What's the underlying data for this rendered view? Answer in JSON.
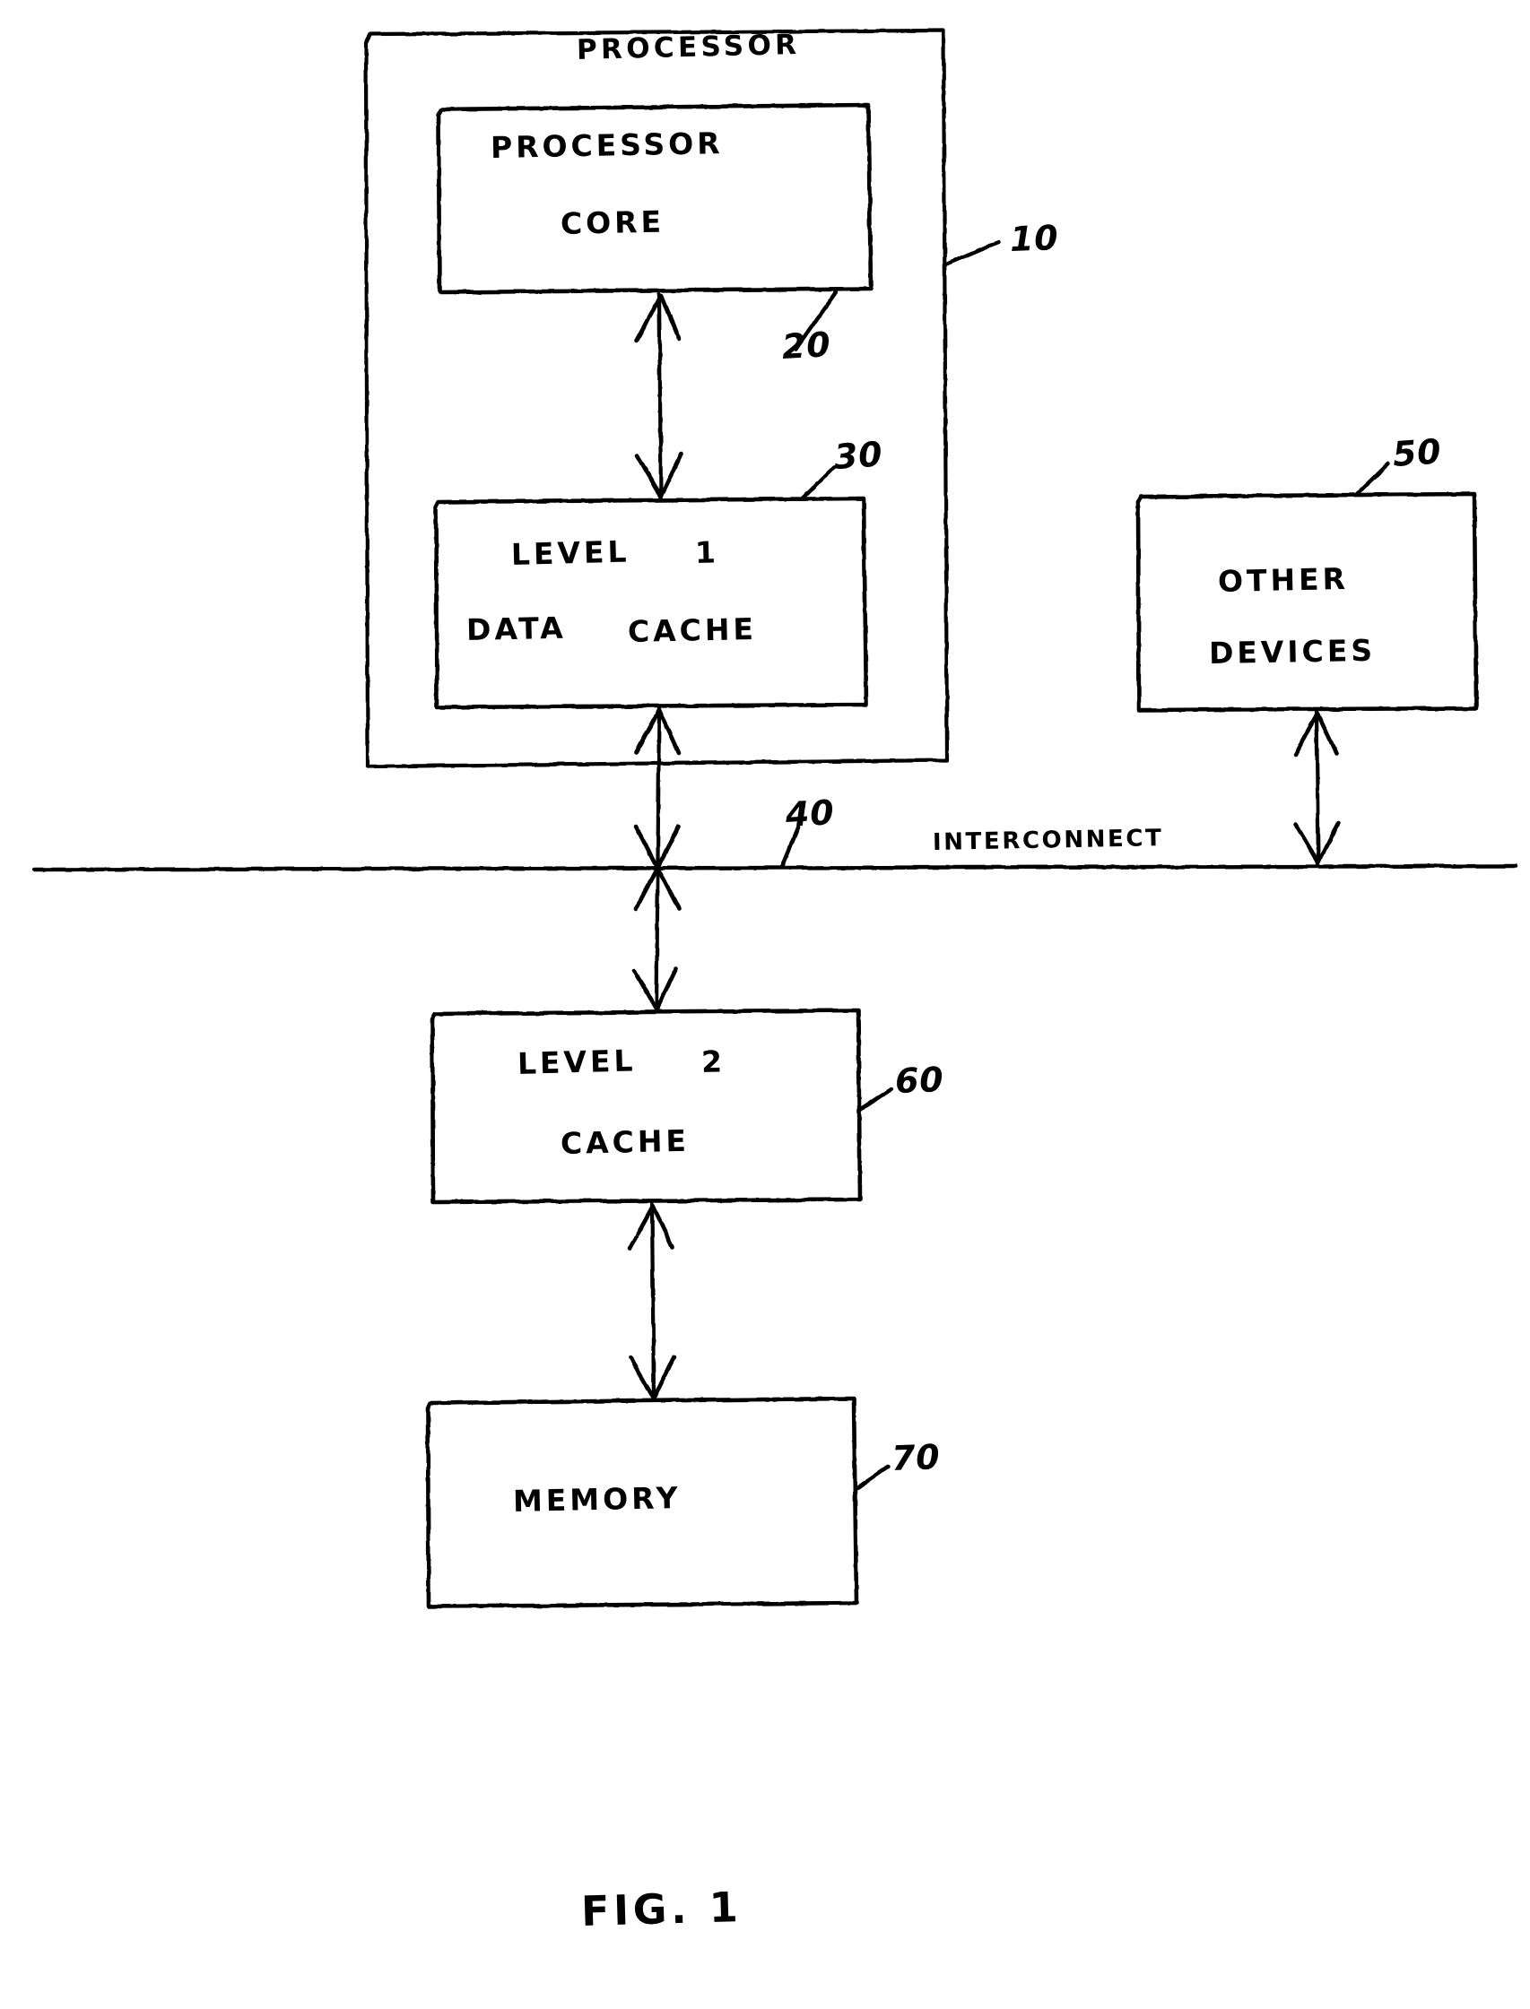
{
  "figure": {
    "caption": "FIG. 1",
    "title_label": "PROCESSOR"
  },
  "blocks": {
    "processor_outer": {
      "label": "PROCESSOR",
      "ref": "10"
    },
    "processor_core": {
      "label_line1": "PROCESSOR",
      "label_line2": "CORE",
      "ref": "20"
    },
    "l1_data_cache": {
      "label_line1": "LEVEL",
      "label_num": "1",
      "label_line2a": "DATA",
      "label_line2b": "CACHE",
      "ref": "30"
    },
    "interconnect": {
      "label": "INTERCONNECT",
      "ref": "40"
    },
    "other_devices": {
      "label_line1": "OTHER",
      "label_line2": "DEVICES",
      "ref": "50"
    },
    "l2_cache": {
      "label_line1": "LEVEL",
      "label_num": "2",
      "label_line2": "CACHE",
      "ref": "60"
    },
    "memory": {
      "label": "MEMORY",
      "ref": "70"
    }
  },
  "connections": [
    {
      "name": "core-to-l1",
      "from": "processor_core",
      "to": "l1_data_cache",
      "style": "double-arrow"
    },
    {
      "name": "l1-to-interconnect",
      "from": "l1_data_cache",
      "to": "interconnect",
      "style": "double-arrow"
    },
    {
      "name": "interconnect-to-l2",
      "from": "interconnect",
      "to": "l2_cache",
      "style": "double-arrow"
    },
    {
      "name": "l2-to-memory",
      "from": "l2_cache",
      "to": "memory",
      "style": "double-arrow"
    },
    {
      "name": "other-devices-to-interconnect",
      "from": "other_devices",
      "to": "interconnect",
      "style": "double-arrow"
    }
  ],
  "colors": {
    "ink": "#000000",
    "paper": "#ffffff"
  }
}
